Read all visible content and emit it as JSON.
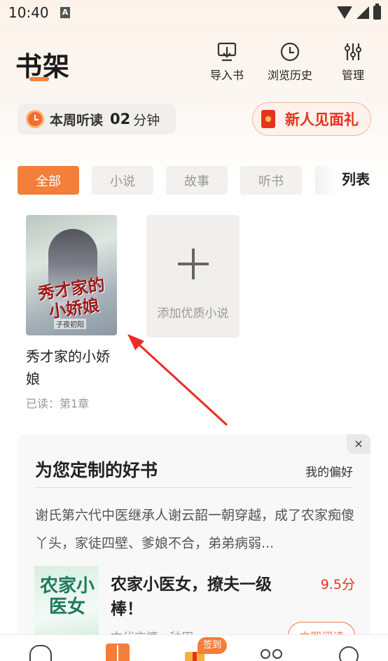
{
  "status_bar": {
    "time": "10:40",
    "notification_letter": "A"
  },
  "header": {
    "title": "书架",
    "actions": [
      {
        "label": "导入书",
        "icon": "import-icon"
      },
      {
        "label": "浏览历史",
        "icon": "history-clock-icon"
      },
      {
        "label": "管理",
        "icon": "sliders-icon"
      }
    ]
  },
  "listen_stats": {
    "label": "本周听读",
    "minutes": "02",
    "unit": "分钟"
  },
  "gift": {
    "label": "新人见面礼"
  },
  "tabs": [
    {
      "label": "全部",
      "active": true
    },
    {
      "label": "小说",
      "active": false
    },
    {
      "label": "故事",
      "active": false
    },
    {
      "label": "听书",
      "active": false
    }
  ],
  "view_toggle": "列表",
  "books": [
    {
      "title": "秀才家的小娇娘",
      "progress": "已读：第1章",
      "cover_title": "秀才家的小娇娘",
      "cover_author": "子夜初阳"
    }
  ],
  "add_book": {
    "label": "添加优质小说"
  },
  "recommendation": {
    "close_label": "×",
    "title": "为您定制的好书",
    "pref_label": "我的偏好",
    "description": "谢氏第六代中医继承人谢云韶一朝穿越，成了农家痴傻丫头，家徒四壁、爹娘不合，弟弟病弱...",
    "book_title": "农家小医女，撩夫一级棒！",
    "score": "9.5分",
    "meta": "古代言情 · 种田",
    "cover_text": "农家小医女",
    "read_label": "立即阅读"
  },
  "bottom_nav": {
    "sign_badge": "签到",
    "active": "shelf",
    "accent": "#f57e3a"
  },
  "colors": {
    "accent": "#f57e3a",
    "gift_red": "#e8321e",
    "score_red": "#e8321e"
  }
}
